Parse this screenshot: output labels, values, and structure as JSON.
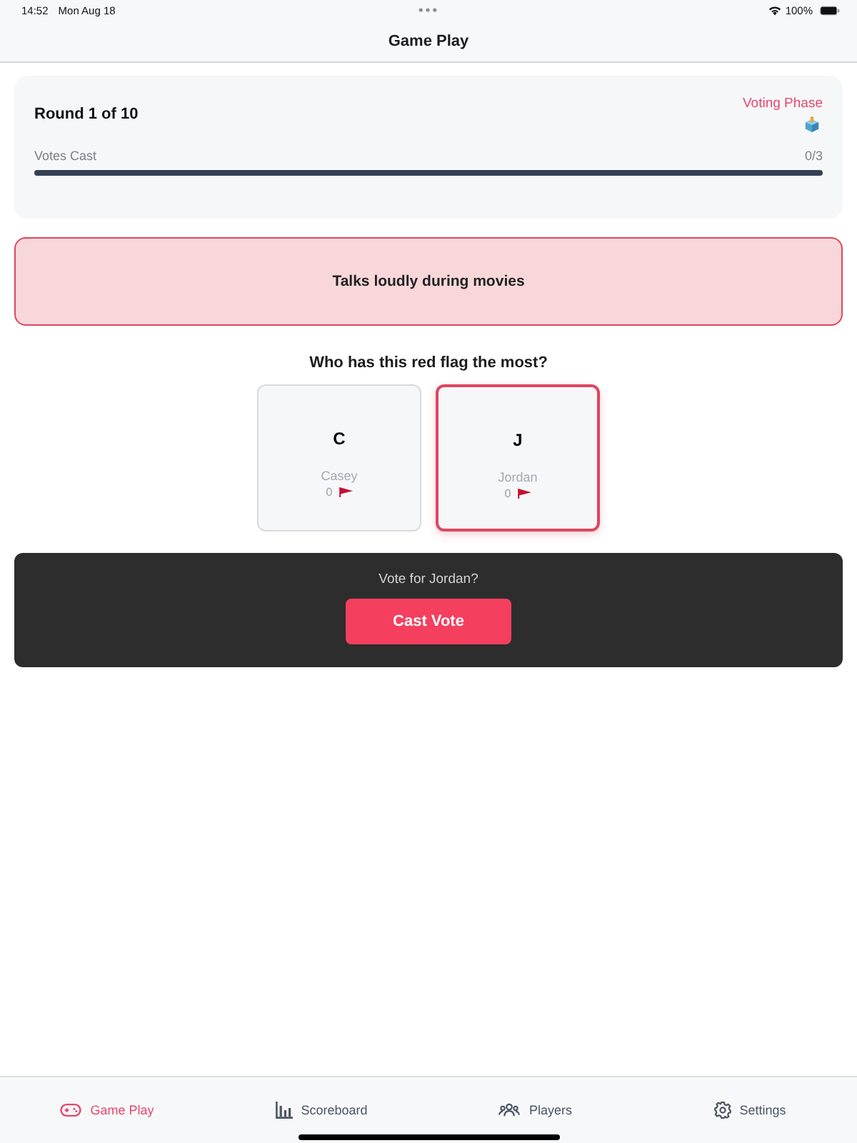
{
  "status_bar": {
    "time": "14:52",
    "date": "Mon Aug 18",
    "battery": "100%"
  },
  "nav": {
    "title": "Game Play"
  },
  "round_card": {
    "round": "Round 1 of 10",
    "phase": "Voting Phase",
    "progress": {
      "label": "Votes Cast",
      "count": "0/3",
      "level": 0
    }
  },
  "red_flag": {
    "text": "Talks loudly during movies"
  },
  "question": "Who has this red flag the most?",
  "players": [
    {
      "initial": "C",
      "name": "Casey",
      "count": "0",
      "selected": false
    },
    {
      "initial": "J",
      "name": "Jordan",
      "count": "0",
      "selected": true
    }
  ],
  "vote_panel": {
    "prompt": "Vote for Jordan?",
    "button": "Cast Vote"
  },
  "tab_bar": [
    {
      "label": "Game Play",
      "kind": "gamepad",
      "selected": true
    },
    {
      "label": "Scoreboard",
      "kind": "chart",
      "selected": false
    },
    {
      "label": "Players",
      "kind": "people",
      "selected": false
    },
    {
      "label": "Settings",
      "kind": "gear",
      "selected": false
    }
  ]
}
